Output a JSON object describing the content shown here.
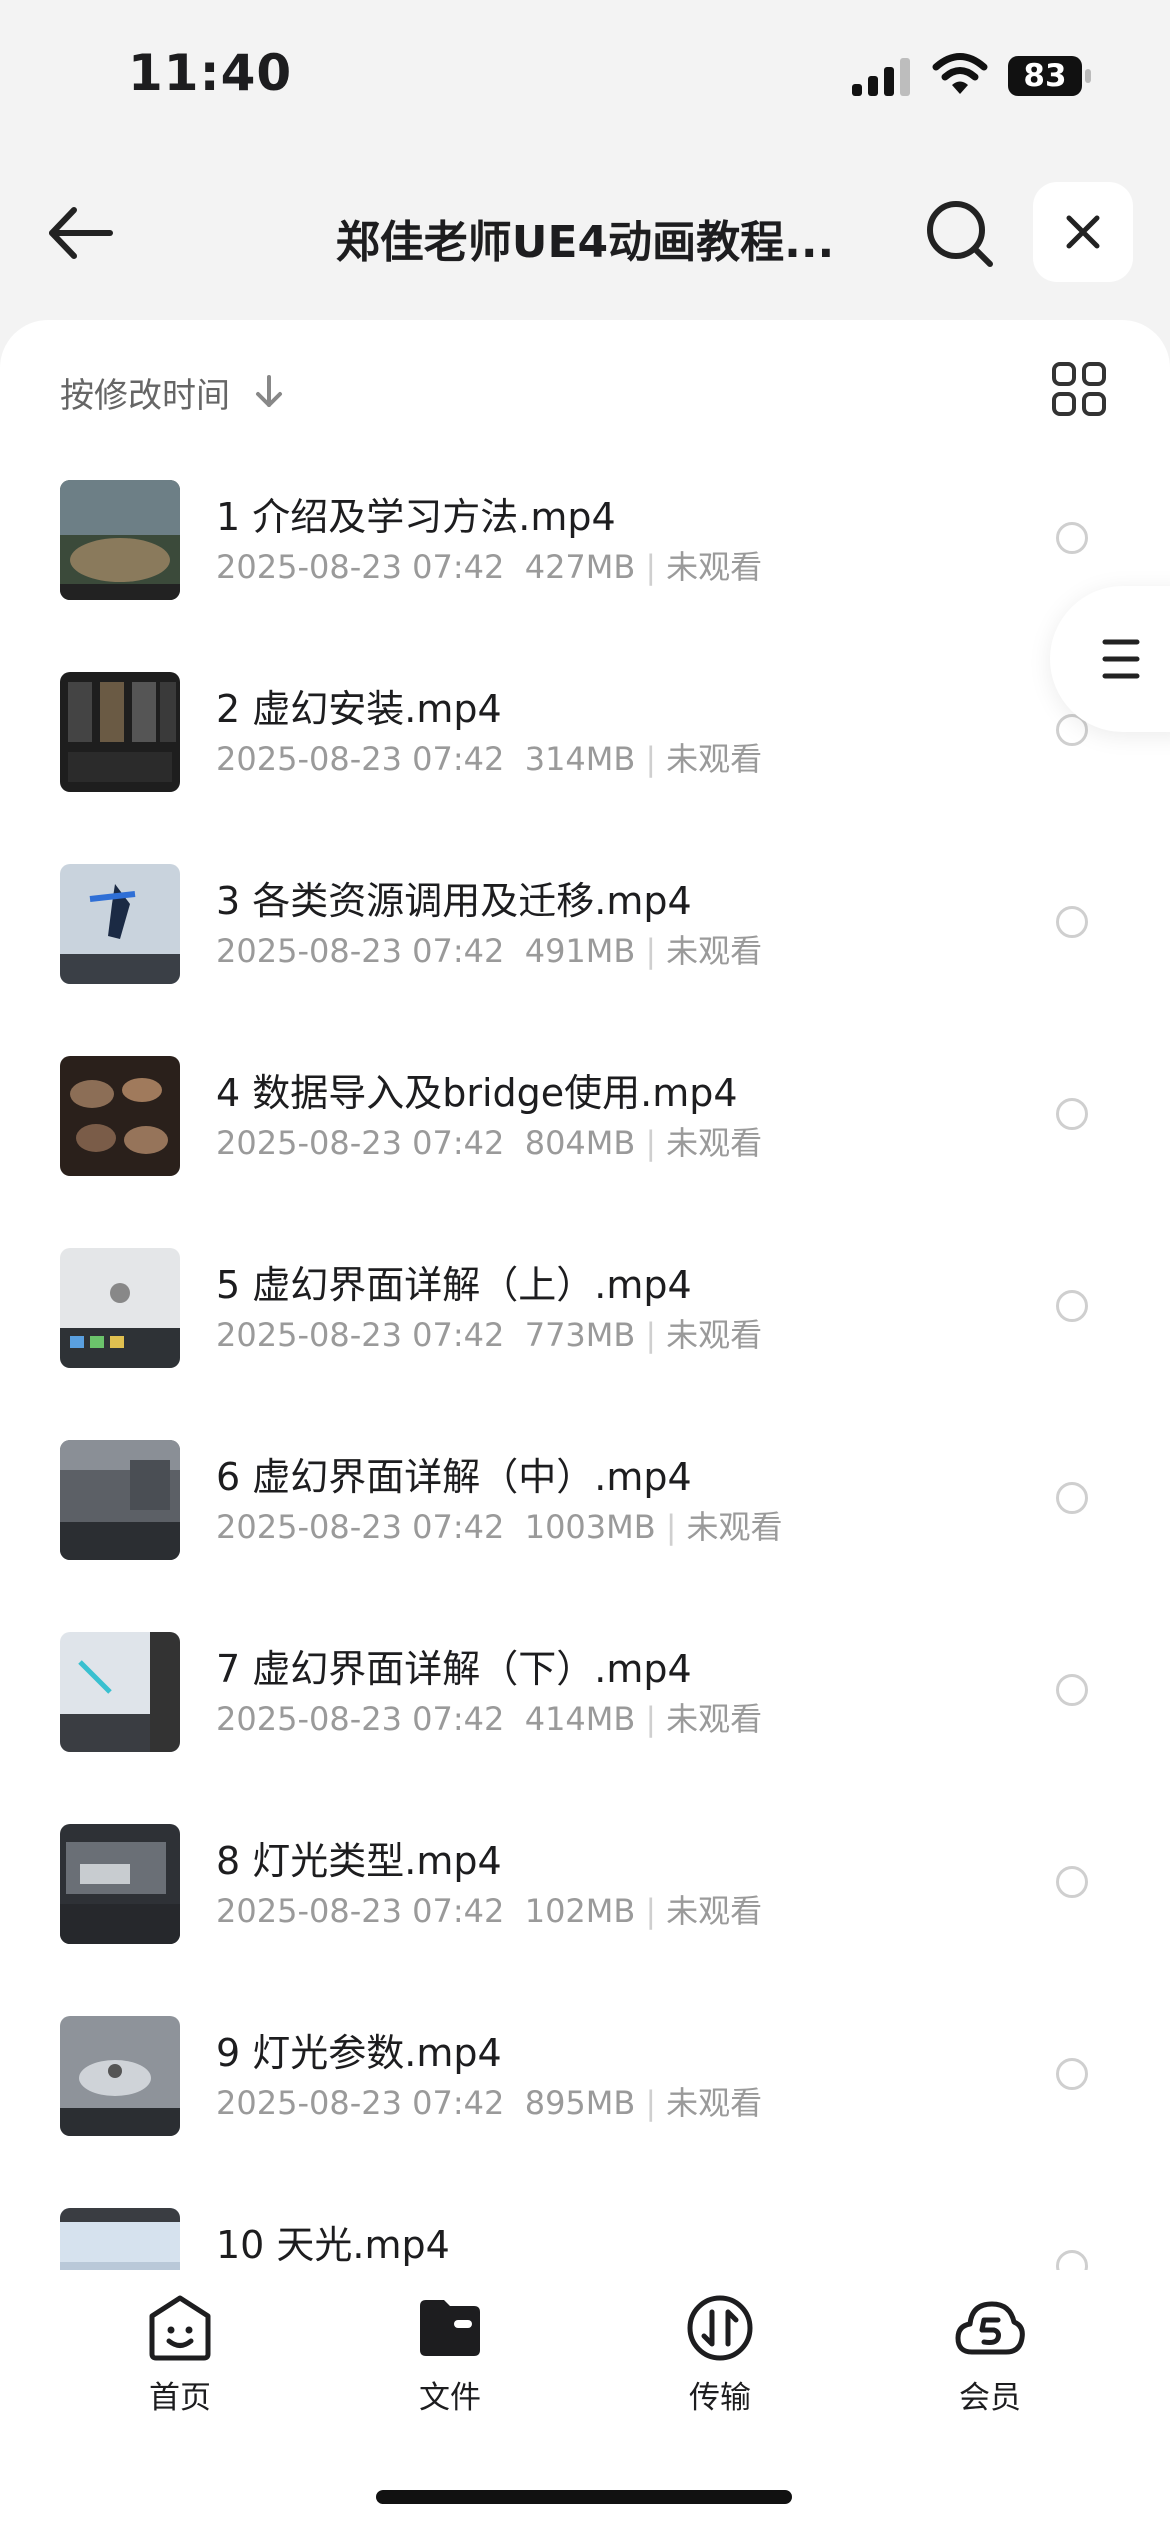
{
  "status_bar": {
    "time": "11:40",
    "battery": "83"
  },
  "nav": {
    "title": "郑佳老师UE4动画教程..."
  },
  "sort": {
    "label": "按修改时间"
  },
  "files": [
    {
      "name": "1 介绍及学习方法.mp4",
      "date": "2025-08-23 07:42",
      "size": "427MB",
      "status": "未观看"
    },
    {
      "name": "2 虚幻安装.mp4",
      "date": "2025-08-23 07:42",
      "size": "314MB",
      "status": "未观看"
    },
    {
      "name": "3 各类资源调用及迁移.mp4",
      "date": "2025-08-23 07:42",
      "size": "491MB",
      "status": "未观看"
    },
    {
      "name": "4 数据导入及bridge使用.mp4",
      "date": "2025-08-23 07:42",
      "size": "804MB",
      "status": "未观看"
    },
    {
      "name": "5 虚幻界面详解（上）.mp4",
      "date": "2025-08-23 07:42",
      "size": "773MB",
      "status": "未观看"
    },
    {
      "name": "6 虚幻界面详解（中）.mp4",
      "date": "2025-08-23 07:42",
      "size": "1003MB",
      "status": "未观看"
    },
    {
      "name": "7 虚幻界面详解（下）.mp4",
      "date": "2025-08-23 07:42",
      "size": "414MB",
      "status": "未观看"
    },
    {
      "name": "8 灯光类型.mp4",
      "date": "2025-08-23 07:42",
      "size": "102MB",
      "status": "未观看"
    },
    {
      "name": "9 灯光参数.mp4",
      "date": "2025-08-23 07:42",
      "size": "895MB",
      "status": "未观看"
    },
    {
      "name": "10 天光.mp4",
      "date": "",
      "size": "",
      "status": ""
    }
  ],
  "tabs": [
    {
      "label": "首页",
      "icon": "smiley-face-icon"
    },
    {
      "label": "文件",
      "icon": "folder-icon"
    },
    {
      "label": "传输",
      "icon": "transfer-arrows-icon"
    },
    {
      "label": "会员",
      "icon": "cloud-s-icon"
    }
  ]
}
